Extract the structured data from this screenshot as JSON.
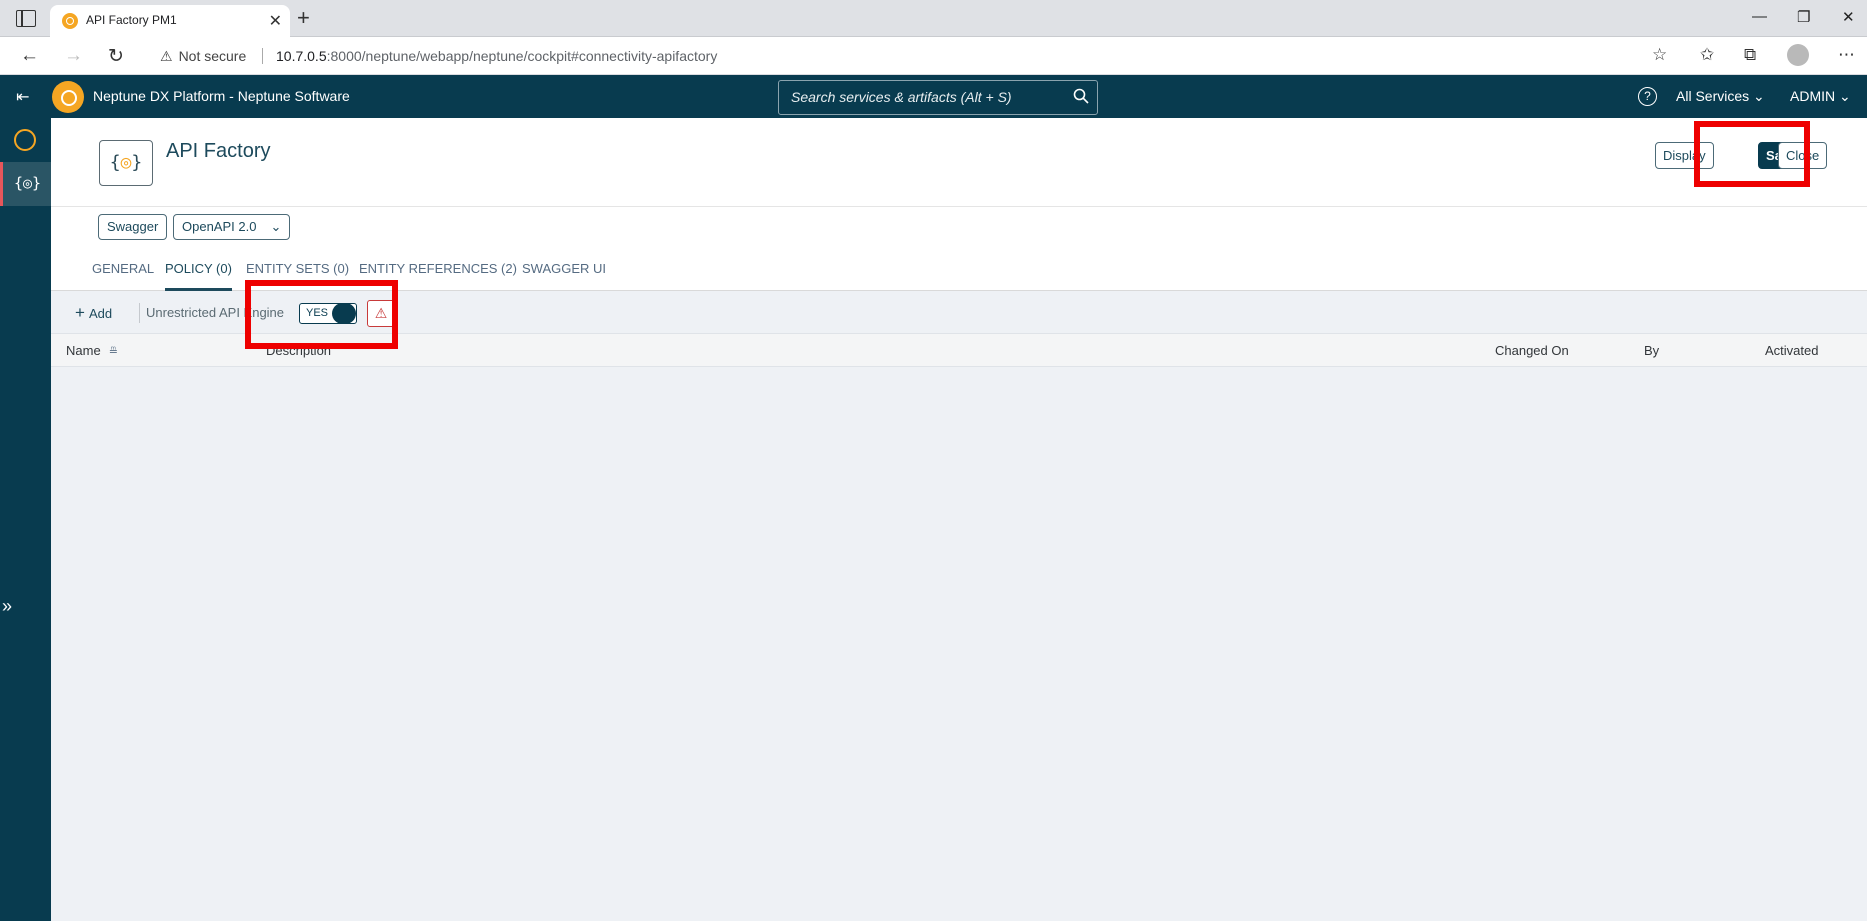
{
  "browser": {
    "tab_title": "API Factory PM1",
    "security_label": "Not secure",
    "url_host": "10.7.0.5",
    "url_rest": ":8000/neptune/webapp/neptune/cockpit#connectivity-apifactory"
  },
  "shell": {
    "title": "Neptune DX Platform  - Neptune Software",
    "search_placeholder": "Search services & artifacts (Alt + S)",
    "all_services": "All Services",
    "user": "ADMIN"
  },
  "header": {
    "title": "API Factory",
    "display_label": "Display",
    "save_label": "Save",
    "close_label": "Close"
  },
  "chips": {
    "type_label": "Swagger",
    "version_label": "OpenAPI 2.0"
  },
  "tabs": [
    {
      "label": "GENERAL"
    },
    {
      "label": "POLICY (0)"
    },
    {
      "label": "ENTITY SETS (0)"
    },
    {
      "label": "ENTITY REFERENCES (2)"
    },
    {
      "label": "SWAGGER UI"
    }
  ],
  "toolbar": {
    "add_label": "Add",
    "engine_label": "Unrestricted API Engine",
    "switch_value": "YES"
  },
  "table": {
    "columns": [
      "Name",
      "Description",
      "Changed On",
      "By",
      "Activated"
    ]
  }
}
